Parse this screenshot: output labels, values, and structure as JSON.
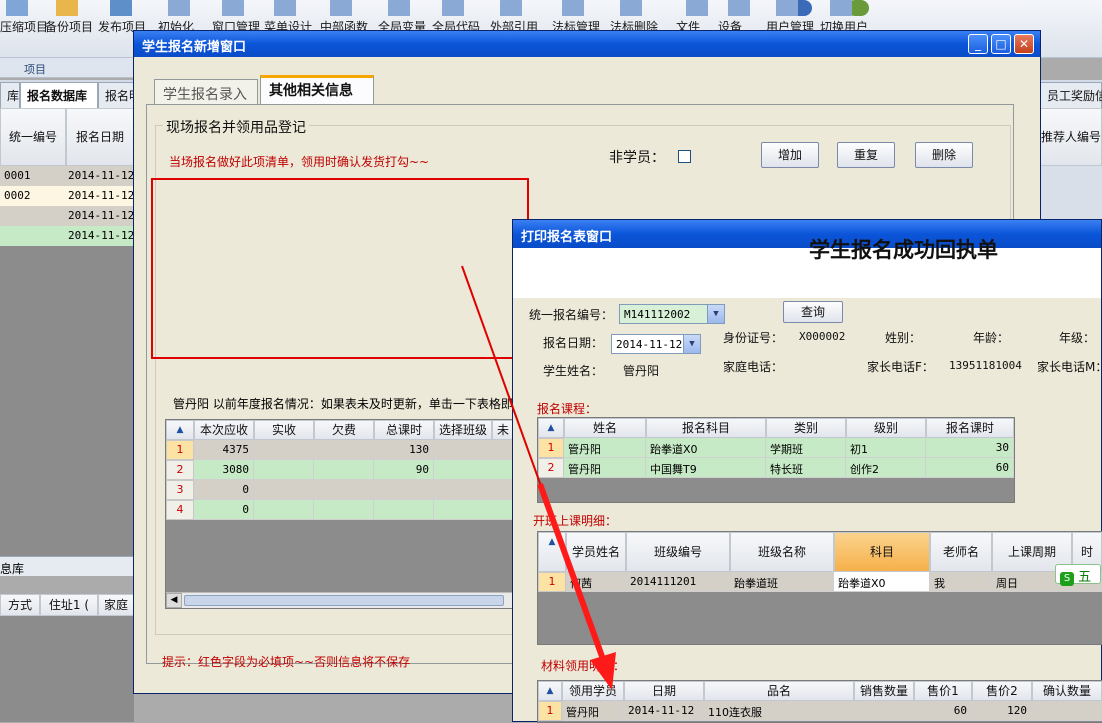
{
  "toolbar": {
    "items": [
      "压缩项目",
      "备份项目",
      "发布项目",
      "初始化",
      "窗口管理",
      "菜单设计",
      "中部函数",
      "全局变量",
      "全局代码",
      "外部引用",
      "法标管理",
      "法标删除",
      "文件",
      "设备",
      "用户管理",
      "切换用户"
    ],
    "group_label": "项目"
  },
  "bg_tabs": [
    "库",
    "报名数据库",
    "报名明",
    "员工奖励信"
  ],
  "bg_grid": {
    "headers": [
      "统一编号",
      "报名日期"
    ],
    "rows": [
      [
        "0001",
        "2014-11-12"
      ],
      [
        "0002",
        "2014-11-12"
      ],
      [
        "",
        "2014-11-12"
      ],
      [
        "",
        "2014-11-12"
      ]
    ],
    "right_header": "推荐人编号"
  },
  "bg_lower": {
    "section": "息库",
    "headers": [
      "方式",
      "住址1 (",
      "家庭"
    ]
  },
  "win1": {
    "title": "学生报名新增窗口",
    "tabs": [
      "学生报名录入",
      "其他相关信息"
    ],
    "group_title": "现场报名并领用品登记",
    "hint": "当场报名做好此项清单，领用时确认发货打勾~~",
    "non_student_label": "非学员：",
    "buttons": [
      "增加",
      "重复",
      "删除"
    ],
    "info_line": "管丹阳   以前年度报名情况：如果表未及时更新，单击一下表格即",
    "grid_headers": [
      "本次应收",
      "实收",
      "欠费",
      "总课时",
      "选择班级",
      "未"
    ],
    "grid_rows": [
      {
        "no": "1",
        "due": "4375",
        "paid": "",
        "owed": "",
        "hours": "130"
      },
      {
        "no": "2",
        "due": "3080",
        "paid": "",
        "owed": "",
        "hours": "90"
      },
      {
        "no": "3",
        "due": "0",
        "paid": "",
        "owed": "",
        "hours": ""
      },
      {
        "no": "4",
        "due": "0",
        "paid": "",
        "owed": "",
        "hours": ""
      }
    ],
    "footer_tip": "提示：红色字段为必填项~~否则信息将不保存"
  },
  "win2": {
    "title": "打印报名表窗口",
    "big_title": "学生报名成功回执单",
    "fields": {
      "reg_no_label": "统一报名编号：",
      "reg_no": "M141112002",
      "query_btn": "查询",
      "date_label": "报名日期：",
      "date": "2014-11-12",
      "id_label": "身份证号：",
      "id": "X000002",
      "gender_label": "姓别：",
      "age_label": "年龄：",
      "grade_label": "年级：",
      "name_label": "学生姓名：",
      "name": "管丹阳",
      "home_phone_label": "家庭电话：",
      "parent_phone_f_label": "家长电话F：",
      "parent_phone_f": "13951181004",
      "parent_phone_m_label": "家长电话M："
    },
    "course_section": "报名课程：",
    "course_headers": [
      "姓名",
      "报名科目",
      "类别",
      "级别",
      "报名课时"
    ],
    "course_rows": [
      {
        "no": "1",
        "name": "管丹阳",
        "subject": "跆拳道X0",
        "type": "学期班",
        "level": "初1",
        "hours": "30"
      },
      {
        "no": "2",
        "name": "管丹阳",
        "subject": "中国舞T9",
        "type": "特长班",
        "level": "创作2",
        "hours": "60"
      }
    ],
    "class_section": "开班上课明细：",
    "class_headers": [
      "学员姓名",
      "班级编号",
      "班级名称",
      "科目",
      "老师名",
      "上课周期",
      "时"
    ],
    "class_rows": [
      {
        "no": "1",
        "student": "何茜",
        "class_no": "2014111201",
        "class_name": "跆拳道班",
        "subject": "跆拳道X0",
        "teacher": "我",
        "period": "周日"
      }
    ],
    "material_section": "材料领用明细：",
    "material_headers": [
      "领用学员",
      "日期",
      "品名",
      "销售数量",
      "售价1",
      "售价2",
      "确认数量"
    ],
    "material_rows": [
      {
        "no": "1",
        "student": "管丹阳",
        "date": "2014-11-12",
        "item": "110连衣服",
        "qty": "",
        "price1": "60",
        "price2": "120",
        "confirm": ""
      }
    ]
  },
  "ime_badge": "五",
  "colors": {
    "accent_red": "#e00000",
    "title_blue": "#0b55d9",
    "green_row": "#c6e9c6"
  }
}
